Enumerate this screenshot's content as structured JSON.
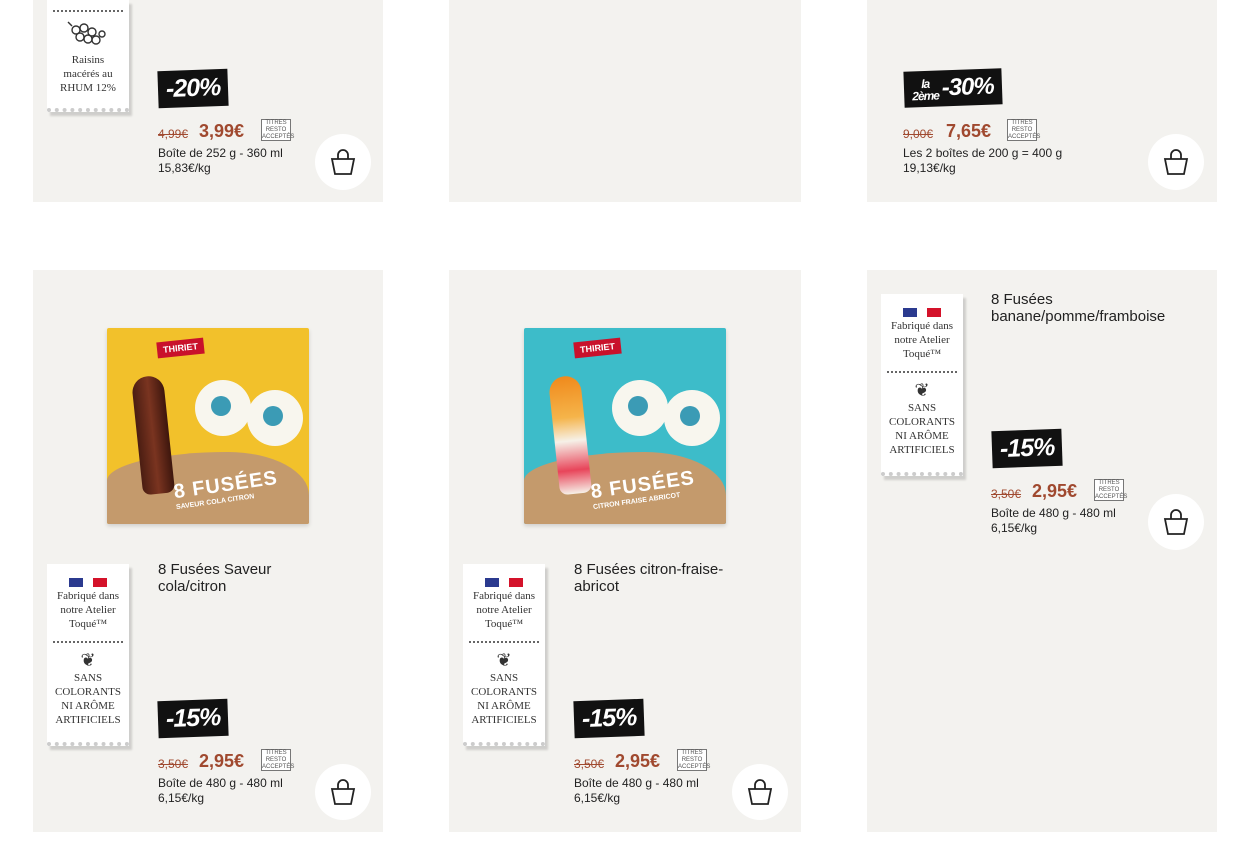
{
  "resto_label": "TITRES RESTO ACCEPTÉS",
  "cart_icon": "shopping-basket-icon",
  "colors": {
    "accent": "#a0492f",
    "card": "#f3f2ef",
    "flag_blue": "#2b3a8f",
    "flag_red": "#d4122a"
  },
  "top_row": [
    {
      "tag": "Raisins macérés au RHUM 12%",
      "promo": "-20%",
      "old_price": "4,99€",
      "price": "3,99€",
      "pack": "Boîte de 252 g - 360 ml",
      "unit": "15,83€/kg"
    },
    {},
    {
      "promo_prefix_1": "la",
      "promo_prefix_2": "2ème",
      "promo": "-30%",
      "old_price": "9,00€",
      "price": "7,65€",
      "pack": "Les 2 boîtes de 200 g = 400 g",
      "unit": "19,13€/kg"
    }
  ],
  "bottom_row": [
    {
      "title": "8 Fusées Saveur cola/citron",
      "brand": "THIRIET",
      "box_text": "8 FUSÉES",
      "box_sub": "SAVEUR COLA CITRON",
      "tag_top": "Fabriqué dans notre Atelier Toqué™",
      "tag_bottom": "SANS COLORANTS NI ARÔME ARTIFICIELS",
      "promo": "-15%",
      "old_price": "3,50€",
      "price": "2,95€",
      "pack": "Boîte de 480 g - 480 ml",
      "unit": "6,15€/kg"
    },
    {
      "title": "8 Fusées citron-fraise-abricot",
      "brand": "THIRIET",
      "box_text": "8 FUSÉES",
      "box_sub": "CITRON FRAISE ABRICOT",
      "tag_top": "Fabriqué dans notre Atelier Toqué™",
      "tag_bottom": "SANS COLORANTS NI ARÔME ARTIFICIELS",
      "promo": "-15%",
      "old_price": "3,50€",
      "price": "2,95€",
      "pack": "Boîte de 480 g - 480 ml",
      "unit": "6,15€/kg"
    },
    {
      "title": "8 Fusées banane/pomme/framboise",
      "tag_top": "Fabriqué dans notre Atelier Toqué™",
      "tag_bottom": "SANS COLORANTS NI ARÔME ARTIFICIELS",
      "promo": "-15%",
      "old_price": "3,50€",
      "price": "2,95€",
      "pack": "Boîte de 480 g - 480 ml",
      "unit": "6,15€/kg"
    }
  ]
}
